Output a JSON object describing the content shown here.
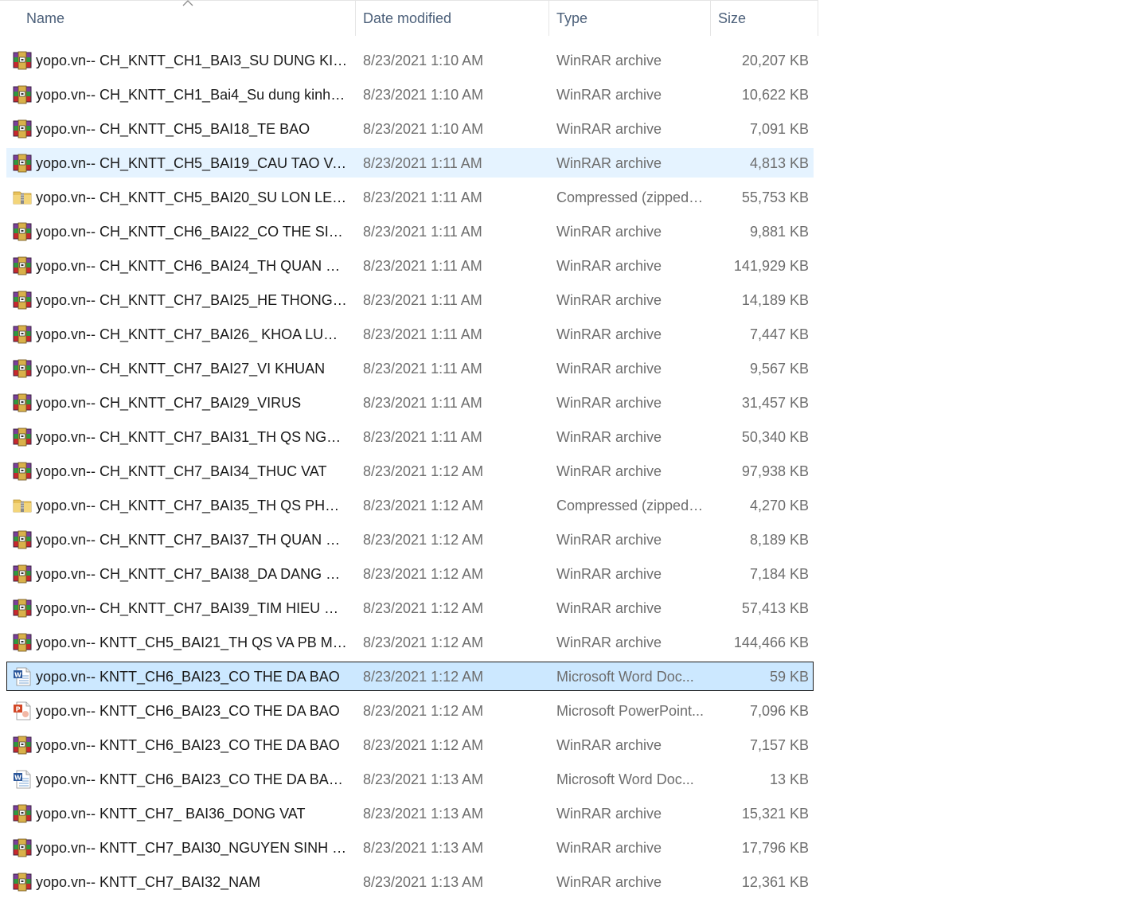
{
  "columns": {
    "name": "Name",
    "date_modified": "Date modified",
    "type": "Type",
    "size": "Size"
  },
  "sort": {
    "column": "name",
    "direction": "ascending"
  },
  "colors": {
    "header_text": "#4c607a",
    "hover_bg": "#e5f3ff",
    "selected_bg": "#cce8ff",
    "secondary_text": "#6d6d6d"
  },
  "files": [
    {
      "name": "yopo.vn-- CH_KNTT_CH1_BAI3_SU DUNG KINH ...",
      "date": "8/23/2021 1:10 AM",
      "type": "WinRAR archive",
      "size": "20,207 KB",
      "icon": "winrar-icon",
      "state": "normal"
    },
    {
      "name": "yopo.vn-- CH_KNTT_CH1_Bai4_Su dung kinh hie...",
      "date": "8/23/2021 1:10 AM",
      "type": "WinRAR archive",
      "size": "10,622 KB",
      "icon": "winrar-icon",
      "state": "normal"
    },
    {
      "name": "yopo.vn-- CH_KNTT_CH5_BAI18_TE BAO",
      "date": "8/23/2021 1:10 AM",
      "type": "WinRAR archive",
      "size": "7,091 KB",
      "icon": "winrar-icon",
      "state": "normal"
    },
    {
      "name": "yopo.vn-- CH_KNTT_CH5_BAI19_CAU TAO VA C...",
      "date": "8/23/2021 1:11 AM",
      "type": "WinRAR archive",
      "size": "4,813 KB",
      "icon": "winrar-icon",
      "state": "hover"
    },
    {
      "name": "yopo.vn-- CH_KNTT_CH5_BAI20_SU LON LEN V...",
      "date": "8/23/2021 1:11 AM",
      "type": "Compressed (zipped)...",
      "size": "55,753 KB",
      "icon": "zip-folder-icon",
      "state": "normal"
    },
    {
      "name": "yopo.vn-- CH_KNTT_CH6_BAI22_CO THE SINH ...",
      "date": "8/23/2021 1:11 AM",
      "type": "WinRAR archive",
      "size": "9,881 KB",
      "icon": "winrar-icon",
      "state": "normal"
    },
    {
      "name": "yopo.vn-- CH_KNTT_CH6_BAI24_TH QUAN SAT...",
      "date": "8/23/2021 1:11 AM",
      "type": "WinRAR archive",
      "size": "141,929 KB",
      "icon": "winrar-icon",
      "state": "normal"
    },
    {
      "name": "yopo.vn-- CH_KNTT_CH7_BAI25_HE THONG PH...",
      "date": "8/23/2021 1:11 AM",
      "type": "WinRAR archive",
      "size": "14,189 KB",
      "icon": "winrar-icon",
      "state": "normal"
    },
    {
      "name": "yopo.vn-- CH_KNTT_CH7_BAI26_ KHOA LUONG...",
      "date": "8/23/2021 1:11 AM",
      "type": "WinRAR archive",
      "size": "7,447 KB",
      "icon": "winrar-icon",
      "state": "normal"
    },
    {
      "name": "yopo.vn-- CH_KNTT_CH7_BAI27_VI KHUAN",
      "date": "8/23/2021 1:11 AM",
      "type": "WinRAR archive",
      "size": "9,567 KB",
      "icon": "winrar-icon",
      "state": "normal"
    },
    {
      "name": "yopo.vn-- CH_KNTT_CH7_BAI29_VIRUS",
      "date": "8/23/2021 1:11 AM",
      "type": "WinRAR archive",
      "size": "31,457 KB",
      "icon": "winrar-icon",
      "state": "normal"
    },
    {
      "name": "yopo.vn-- CH_KNTT_CH7_BAI31_TH QS NGUYE...",
      "date": "8/23/2021 1:11 AM",
      "type": "WinRAR archive",
      "size": "50,340 KB",
      "icon": "winrar-icon",
      "state": "normal"
    },
    {
      "name": "yopo.vn-- CH_KNTT_CH7_BAI34_THUC VAT",
      "date": "8/23/2021 1:12 AM",
      "type": "WinRAR archive",
      "size": "97,938 KB",
      "icon": "winrar-icon",
      "state": "normal"
    },
    {
      "name": "yopo.vn-- CH_KNTT_CH7_BAI35_TH QS PHAN B...",
      "date": "8/23/2021 1:12 AM",
      "type": "Compressed (zipped)...",
      "size": "4,270 KB",
      "icon": "zip-folder-icon",
      "state": "normal"
    },
    {
      "name": "yopo.vn-- CH_KNTT_CH7_BAI37_TH QUAN SAT ...",
      "date": "8/23/2021 1:12 AM",
      "type": "WinRAR archive",
      "size": "8,189 KB",
      "icon": "winrar-icon",
      "state": "normal"
    },
    {
      "name": "yopo.vn-- CH_KNTT_CH7_BAI38_DA DANG SIN...",
      "date": "8/23/2021 1:12 AM",
      "type": "WinRAR archive",
      "size": "7,184 KB",
      "icon": "winrar-icon",
      "state": "normal"
    },
    {
      "name": "yopo.vn-- CH_KNTT_CH7_BAI39_TIM HIEU VE T...",
      "date": "8/23/2021 1:12 AM",
      "type": "WinRAR archive",
      "size": "57,413 KB",
      "icon": "winrar-icon",
      "state": "normal"
    },
    {
      "name": "yopo.vn-- KNTT_CH5_BAI21_TH QS VA PB MOT ...",
      "date": "8/23/2021 1:12 AM",
      "type": "WinRAR archive",
      "size": "144,466 KB",
      "icon": "winrar-icon",
      "state": "normal"
    },
    {
      "name": "yopo.vn-- KNTT_CH6_BAI23_CO THE DA BAO",
      "date": "8/23/2021 1:12 AM",
      "type": "Microsoft Word Doc...",
      "size": "59 KB",
      "icon": "word-doc-icon",
      "state": "selected"
    },
    {
      "name": "yopo.vn-- KNTT_CH6_BAI23_CO THE DA BAO",
      "date": "8/23/2021 1:12 AM",
      "type": "Microsoft PowerPoint...",
      "size": "7,096 KB",
      "icon": "powerpoint-icon",
      "state": "normal"
    },
    {
      "name": "yopo.vn-- KNTT_CH6_BAI23_CO THE DA BAO",
      "date": "8/23/2021 1:12 AM",
      "type": "WinRAR archive",
      "size": "7,157 KB",
      "icon": "winrar-icon",
      "state": "normal"
    },
    {
      "name": "yopo.vn-- KNTT_CH6_BAI23_CO THE DA BAO_P...",
      "date": "8/23/2021 1:13 AM",
      "type": "Microsoft Word Doc...",
      "size": "13 KB",
      "icon": "word-doc-icon",
      "state": "normal"
    },
    {
      "name": "yopo.vn-- KNTT_CH7_ BAI36_DONG VAT",
      "date": "8/23/2021 1:13 AM",
      "type": "WinRAR archive",
      "size": "15,321 KB",
      "icon": "winrar-icon",
      "state": "normal"
    },
    {
      "name": "yopo.vn-- KNTT_CH7_BAI30_NGUYEN SINH VAT",
      "date": "8/23/2021 1:13 AM",
      "type": "WinRAR archive",
      "size": "17,796 KB",
      "icon": "winrar-icon",
      "state": "normal"
    },
    {
      "name": "yopo.vn-- KNTT_CH7_BAI32_NAM",
      "date": "8/23/2021 1:13 AM",
      "type": "WinRAR archive",
      "size": "12,361 KB",
      "icon": "winrar-icon",
      "state": "normal"
    }
  ]
}
